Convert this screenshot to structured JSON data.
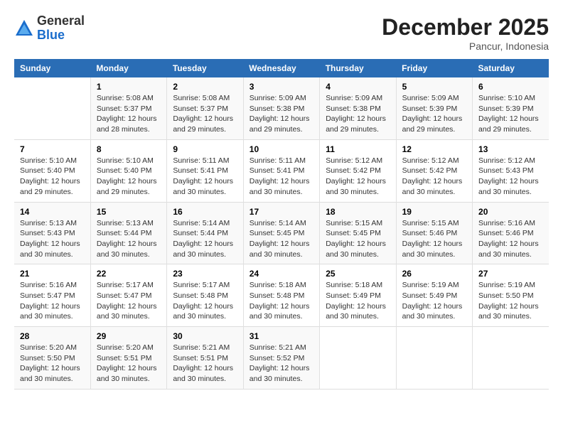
{
  "logo": {
    "general": "General",
    "blue": "Blue"
  },
  "title": "December 2025",
  "subtitle": "Pancur, Indonesia",
  "days_header": [
    "Sunday",
    "Monday",
    "Tuesday",
    "Wednesday",
    "Thursday",
    "Friday",
    "Saturday"
  ],
  "weeks": [
    [
      {
        "day": "",
        "info": ""
      },
      {
        "day": "1",
        "info": "Sunrise: 5:08 AM\nSunset: 5:37 PM\nDaylight: 12 hours\nand 28 minutes."
      },
      {
        "day": "2",
        "info": "Sunrise: 5:08 AM\nSunset: 5:37 PM\nDaylight: 12 hours\nand 29 minutes."
      },
      {
        "day": "3",
        "info": "Sunrise: 5:09 AM\nSunset: 5:38 PM\nDaylight: 12 hours\nand 29 minutes."
      },
      {
        "day": "4",
        "info": "Sunrise: 5:09 AM\nSunset: 5:38 PM\nDaylight: 12 hours\nand 29 minutes."
      },
      {
        "day": "5",
        "info": "Sunrise: 5:09 AM\nSunset: 5:39 PM\nDaylight: 12 hours\nand 29 minutes."
      },
      {
        "day": "6",
        "info": "Sunrise: 5:10 AM\nSunset: 5:39 PM\nDaylight: 12 hours\nand 29 minutes."
      }
    ],
    [
      {
        "day": "7",
        "info": "Sunrise: 5:10 AM\nSunset: 5:40 PM\nDaylight: 12 hours\nand 29 minutes."
      },
      {
        "day": "8",
        "info": "Sunrise: 5:10 AM\nSunset: 5:40 PM\nDaylight: 12 hours\nand 29 minutes."
      },
      {
        "day": "9",
        "info": "Sunrise: 5:11 AM\nSunset: 5:41 PM\nDaylight: 12 hours\nand 30 minutes."
      },
      {
        "day": "10",
        "info": "Sunrise: 5:11 AM\nSunset: 5:41 PM\nDaylight: 12 hours\nand 30 minutes."
      },
      {
        "day": "11",
        "info": "Sunrise: 5:12 AM\nSunset: 5:42 PM\nDaylight: 12 hours\nand 30 minutes."
      },
      {
        "day": "12",
        "info": "Sunrise: 5:12 AM\nSunset: 5:42 PM\nDaylight: 12 hours\nand 30 minutes."
      },
      {
        "day": "13",
        "info": "Sunrise: 5:12 AM\nSunset: 5:43 PM\nDaylight: 12 hours\nand 30 minutes."
      }
    ],
    [
      {
        "day": "14",
        "info": "Sunrise: 5:13 AM\nSunset: 5:43 PM\nDaylight: 12 hours\nand 30 minutes."
      },
      {
        "day": "15",
        "info": "Sunrise: 5:13 AM\nSunset: 5:44 PM\nDaylight: 12 hours\nand 30 minutes."
      },
      {
        "day": "16",
        "info": "Sunrise: 5:14 AM\nSunset: 5:44 PM\nDaylight: 12 hours\nand 30 minutes."
      },
      {
        "day": "17",
        "info": "Sunrise: 5:14 AM\nSunset: 5:45 PM\nDaylight: 12 hours\nand 30 minutes."
      },
      {
        "day": "18",
        "info": "Sunrise: 5:15 AM\nSunset: 5:45 PM\nDaylight: 12 hours\nand 30 minutes."
      },
      {
        "day": "19",
        "info": "Sunrise: 5:15 AM\nSunset: 5:46 PM\nDaylight: 12 hours\nand 30 minutes."
      },
      {
        "day": "20",
        "info": "Sunrise: 5:16 AM\nSunset: 5:46 PM\nDaylight: 12 hours\nand 30 minutes."
      }
    ],
    [
      {
        "day": "21",
        "info": "Sunrise: 5:16 AM\nSunset: 5:47 PM\nDaylight: 12 hours\nand 30 minutes."
      },
      {
        "day": "22",
        "info": "Sunrise: 5:17 AM\nSunset: 5:47 PM\nDaylight: 12 hours\nand 30 minutes."
      },
      {
        "day": "23",
        "info": "Sunrise: 5:17 AM\nSunset: 5:48 PM\nDaylight: 12 hours\nand 30 minutes."
      },
      {
        "day": "24",
        "info": "Sunrise: 5:18 AM\nSunset: 5:48 PM\nDaylight: 12 hours\nand 30 minutes."
      },
      {
        "day": "25",
        "info": "Sunrise: 5:18 AM\nSunset: 5:49 PM\nDaylight: 12 hours\nand 30 minutes."
      },
      {
        "day": "26",
        "info": "Sunrise: 5:19 AM\nSunset: 5:49 PM\nDaylight: 12 hours\nand 30 minutes."
      },
      {
        "day": "27",
        "info": "Sunrise: 5:19 AM\nSunset: 5:50 PM\nDaylight: 12 hours\nand 30 minutes."
      }
    ],
    [
      {
        "day": "28",
        "info": "Sunrise: 5:20 AM\nSunset: 5:50 PM\nDaylight: 12 hours\nand 30 minutes."
      },
      {
        "day": "29",
        "info": "Sunrise: 5:20 AM\nSunset: 5:51 PM\nDaylight: 12 hours\nand 30 minutes."
      },
      {
        "day": "30",
        "info": "Sunrise: 5:21 AM\nSunset: 5:51 PM\nDaylight: 12 hours\nand 30 minutes."
      },
      {
        "day": "31",
        "info": "Sunrise: 5:21 AM\nSunset: 5:52 PM\nDaylight: 12 hours\nand 30 minutes."
      },
      {
        "day": "",
        "info": ""
      },
      {
        "day": "",
        "info": ""
      },
      {
        "day": "",
        "info": ""
      }
    ]
  ]
}
